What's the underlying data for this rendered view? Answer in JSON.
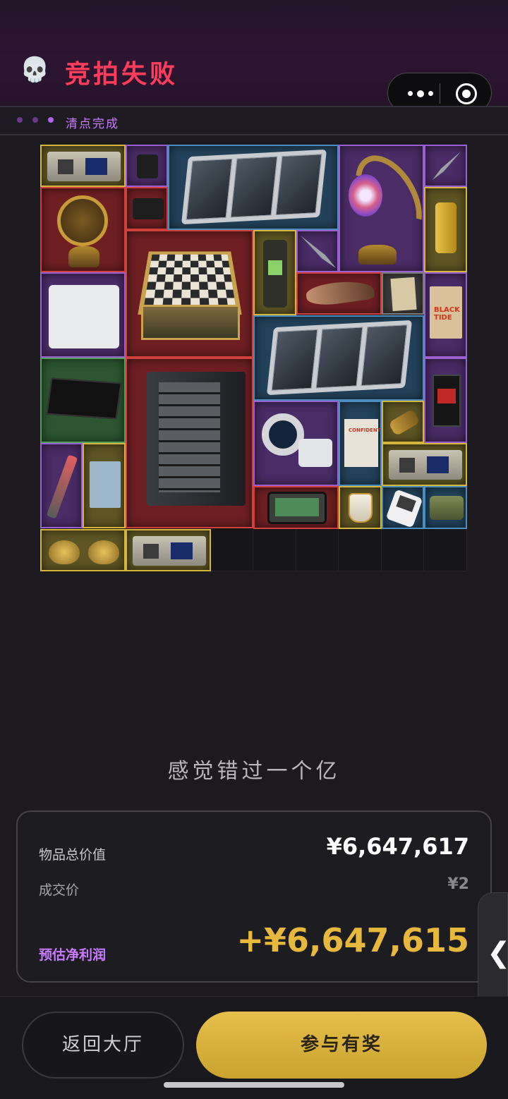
{
  "header": {
    "title": "竞拍失败",
    "icon": "skull-icon"
  },
  "capsule": {
    "more_icon": "more-dots-icon",
    "close_icon": "target-icon"
  },
  "status": {
    "text": "清点完成"
  },
  "items": [
    {
      "name": "handheld-device",
      "rarity": "gold"
    },
    {
      "name": "tactical-clip",
      "rarity": "purple"
    },
    {
      "name": "solar-panel",
      "rarity": "blue"
    },
    {
      "name": "moon-lamp",
      "rarity": "purple"
    },
    {
      "name": "knife",
      "rarity": "purple"
    },
    {
      "name": "armillary-sphere",
      "rarity": "red"
    },
    {
      "name": "wrist-strap",
      "rarity": "red"
    },
    {
      "name": "fuel-tank",
      "rarity": "gold"
    },
    {
      "name": "chess-set",
      "rarity": "red"
    },
    {
      "name": "satellite-radio",
      "rarity": "gold"
    },
    {
      "name": "spearhead",
      "rarity": "purple"
    },
    {
      "name": "centrifuge",
      "rarity": "purple"
    },
    {
      "name": "claw-fossil",
      "rarity": "red"
    },
    {
      "name": "paper-note",
      "rarity": "gray"
    },
    {
      "name": "black-tide-book",
      "rarity": "gold"
    },
    {
      "name": "solar-panel",
      "rarity": "blue"
    },
    {
      "name": "power-supply",
      "rarity": "green"
    },
    {
      "name": "server-rack",
      "rarity": "red"
    },
    {
      "name": "supply-pouch",
      "rarity": "purple"
    },
    {
      "name": "spotting-scope",
      "rarity": "purple"
    },
    {
      "name": "confidential-file",
      "rarity": "blue"
    },
    {
      "name": "battery-cell",
      "rarity": "gold"
    },
    {
      "name": "pipe-wrench",
      "rarity": "purple"
    },
    {
      "name": "notebook",
      "rarity": "gold"
    },
    {
      "name": "handheld-device",
      "rarity": "gold"
    },
    {
      "name": "tablet",
      "rarity": "red"
    },
    {
      "name": "porcelain-cup",
      "rarity": "gold"
    },
    {
      "name": "mp3-player",
      "rarity": "blue"
    },
    {
      "name": "ration-can",
      "rarity": "blue"
    },
    {
      "name": "sunglasses",
      "rarity": "gold"
    },
    {
      "name": "handheld-device",
      "rarity": "gold"
    }
  ],
  "item_text": {
    "book_title": "BLACK TIDE",
    "file_title": "CONFIDENTIAL"
  },
  "tagline": "感觉错过一个亿",
  "summary": {
    "total_label": "物品总价值",
    "total_value": "¥6,647,617",
    "deal_label": "成交价",
    "deal_value": "¥2",
    "profit_label": "预估净利润",
    "profit_value": "+¥6,647,615"
  },
  "side_tab": {
    "icon": "chevron-left-icon",
    "glyph": "❮"
  },
  "buttons": {
    "back_label": "返回大厅",
    "join_label": "参与有奖"
  },
  "colors": {
    "title": "#ff3d5a",
    "accent": "#c77cff",
    "gold": "#e6b93c",
    "join_button": "#d9b23c"
  }
}
